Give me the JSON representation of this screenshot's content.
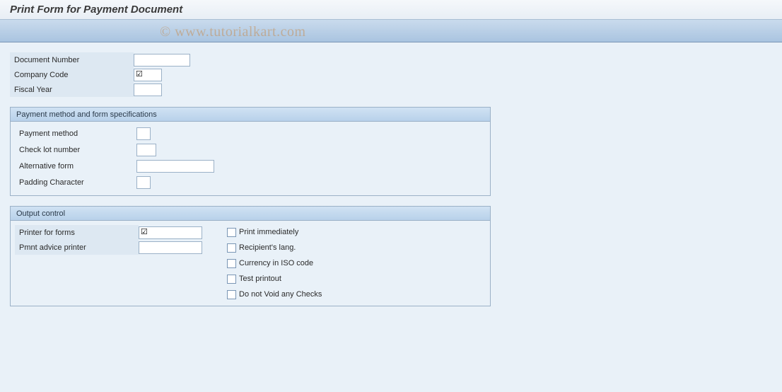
{
  "title": "Print Form for Payment Document",
  "watermark": "© www.tutorialkart.com",
  "top_fields": {
    "document_number": {
      "label": "Document Number",
      "value": ""
    },
    "company_code": {
      "label": "Company Code",
      "value": ""
    },
    "fiscal_year": {
      "label": "Fiscal Year",
      "value": ""
    }
  },
  "group_payment": {
    "title": "Payment method and form specifications",
    "payment_method": {
      "label": "Payment method",
      "value": ""
    },
    "check_lot_number": {
      "label": "Check lot number",
      "value": ""
    },
    "alternative_form": {
      "label": "Alternative form",
      "value": ""
    },
    "padding_character": {
      "label": "Padding Character",
      "value": ""
    }
  },
  "group_output": {
    "title": "Output control",
    "printer_for_forms": {
      "label": "Printer for forms",
      "value": ""
    },
    "pmnt_advice_printer": {
      "label": "Pmnt advice printer",
      "value": ""
    },
    "checkboxes": [
      {
        "label": "Print immediately",
        "checked": false
      },
      {
        "label": "Recipient's lang.",
        "checked": false
      },
      {
        "label": "Currency in ISO code",
        "checked": false
      },
      {
        "label": "Test printout",
        "checked": false
      },
      {
        "label": "Do not Void any Checks",
        "checked": false
      }
    ]
  }
}
